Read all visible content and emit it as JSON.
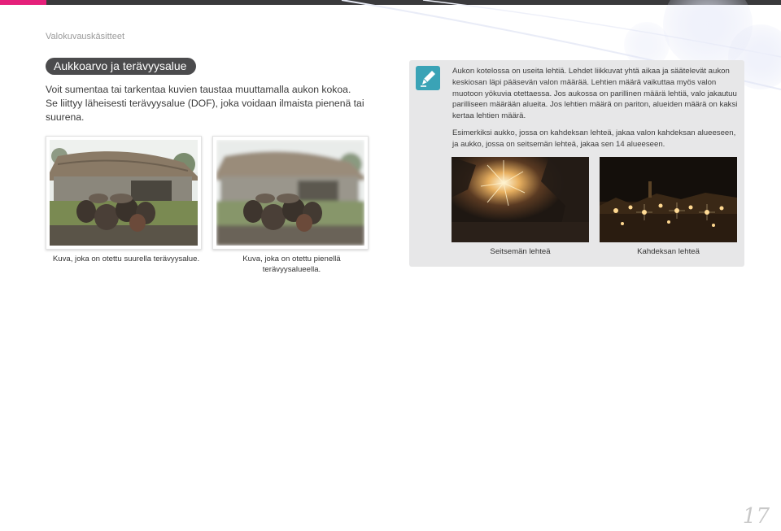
{
  "header": {
    "chapter_title": "Valokuvauskäsitteet"
  },
  "section": {
    "title": "Aukkoarvo ja terävyysalue",
    "intro_line1": "Voit sumentaa tai tarkentaa kuvien taustaa muuttamalla aukon kokoa.",
    "intro_line2": "Se liittyy läheisesti terävyysalue (DOF), joka voidaan ilmaista pienenä tai suurena."
  },
  "photos": {
    "left_caption": "Kuva, joka on otettu suurella terävyysalue.",
    "right_caption": "Kuva, joka on otettu pienellä terävyysalueella."
  },
  "note": {
    "icon": "pencil-note-icon",
    "para1": "Aukon kotelossa on useita lehtiä. Lehdet liikkuvat yhtä aikaa ja säätelevät aukon keskiosan läpi pääsevän valon määrää. Lehtien määrä vaikuttaa myös valon muotoon yökuvia otettaessa. Jos aukossa on parillinen määrä lehtiä, valo jakautuu parilliseen määrään alueita. Jos lehtien määrä on pariton, alueiden määrä on kaksi kertaa lehtien määrä.",
    "para2": "Esimerkiksi aukko, jossa on kahdeksan lehteä, jakaa valon kahdeksan alueeseen, ja aukko, jossa on seitsemän lehteä, jakaa sen 14 alueeseen.",
    "caption_seven": "Seitsemän lehteä",
    "caption_eight": "Kahdeksan lehteä"
  },
  "colors": {
    "accent_pink": "#e5207a",
    "bar_dark": "#3a3a3c",
    "pill": "#4b4b4d",
    "note_bg": "#e7e7e8",
    "icon_teal": "#3aa3b6"
  },
  "footer": {
    "page_number": "17"
  }
}
